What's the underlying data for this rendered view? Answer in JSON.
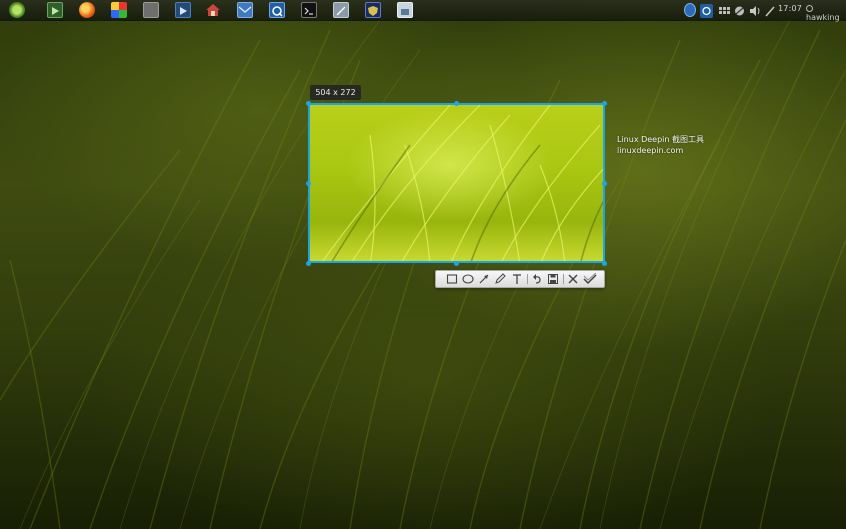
{
  "panel": {
    "launchers": [
      "deepin-logo-icon",
      "terminal-green-icon",
      "firefox-icon",
      "color-palette-icon",
      "disk-icon",
      "media-player-icon",
      "home-icon",
      "mail-icon",
      "qq-icon",
      "terminal-icon",
      "text-editor-icon",
      "shield-icon",
      "document-icon"
    ],
    "tray": [
      "settings-icon",
      "qq-tray-icon",
      "grid-icon",
      "network-icon",
      "volume-icon",
      "pen-icon"
    ],
    "clock": "17:07",
    "username": "hawking"
  },
  "capture": {
    "size_label": "504 x 272",
    "watermark_line1": "Linux Deepin 截图工具",
    "watermark_line2": "linuxdeepin.com"
  },
  "toolbar": {
    "tools": [
      "rectangle-icon",
      "ellipse-icon",
      "arrow-icon",
      "pen-icon",
      "text-icon",
      "undo-icon",
      "save-icon",
      "cancel-icon",
      "confirm-icon"
    ]
  },
  "colors": {
    "selection_border": "#18a6e8",
    "panel_bg": "#1e2313",
    "toolbar_bg": "#efefef"
  }
}
